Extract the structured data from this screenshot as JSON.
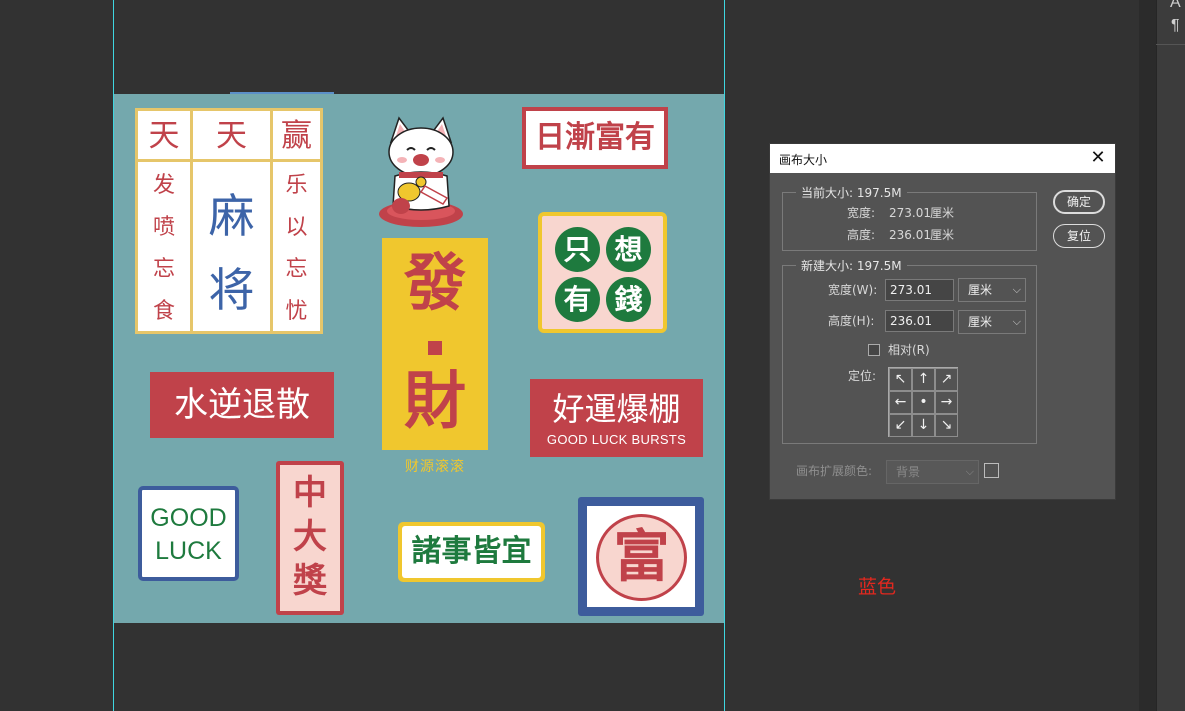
{
  "canvas": {
    "background": "#74a8ad",
    "stickers": {
      "mahjong": {
        "top": [
          "天",
          "天",
          "赢"
        ],
        "left_col": [
          "发",
          "喷",
          "忘",
          "食"
        ],
        "middle": [
          "麻",
          "将"
        ],
        "right_col": [
          "乐",
          "以",
          "忘",
          "忧"
        ]
      },
      "fa_cai": {
        "char1": "發",
        "char2": "財",
        "caption": "财源滚滚"
      },
      "rijian": "日漸富有",
      "zhixiang": [
        "只",
        "想",
        "有",
        "錢"
      ],
      "shuini": "水逆退散",
      "haoyun": {
        "chinese": "好運爆棚",
        "english": "GOOD LUCK BURSTS"
      },
      "goodluck": {
        "line1": "GOOD",
        "line2": "LUCK"
      },
      "zhongda": [
        "中",
        "大",
        "獎"
      ],
      "zhushi": "諸事皆宜",
      "fu": "富"
    }
  },
  "dialog": {
    "title": "画布大小",
    "current_size": {
      "legend": "当前大小: 197.5M",
      "width_label": "宽度:",
      "width_value": "273.01",
      "width_unit": "厘米",
      "height_label": "高度:",
      "height_value": "236.01",
      "height_unit": "厘米"
    },
    "new_size": {
      "legend": "新建大小: 197.5M",
      "width_label": "宽度(W):",
      "width_value": "273.01",
      "width_unit": "厘米",
      "height_label": "高度(H):",
      "height_value": "236.01",
      "height_unit": "厘米",
      "relative_label": "相对(R)",
      "relative_checked": false,
      "anchor_label": "定位:",
      "anchor_arrows": [
        "↖",
        "↑",
        "↗",
        "←",
        "•",
        "→",
        "↙",
        "↓",
        "↘"
      ]
    },
    "extension_color_label": "画布扩展颜色:",
    "extension_color_value": "背景",
    "ok_button": "确定",
    "reset_button": "复位"
  },
  "panel_glyphs": {
    "top": "A",
    "paragraph": "¶"
  },
  "annotation": "蓝色",
  "colors": {
    "app_bg": "#323232",
    "guide": "#3fd6e0",
    "red": "#c0424a",
    "yellow": "#f0c72e",
    "green": "#1e7a3e",
    "blue": "#3d5c9c",
    "annotation": "#e0281f"
  }
}
